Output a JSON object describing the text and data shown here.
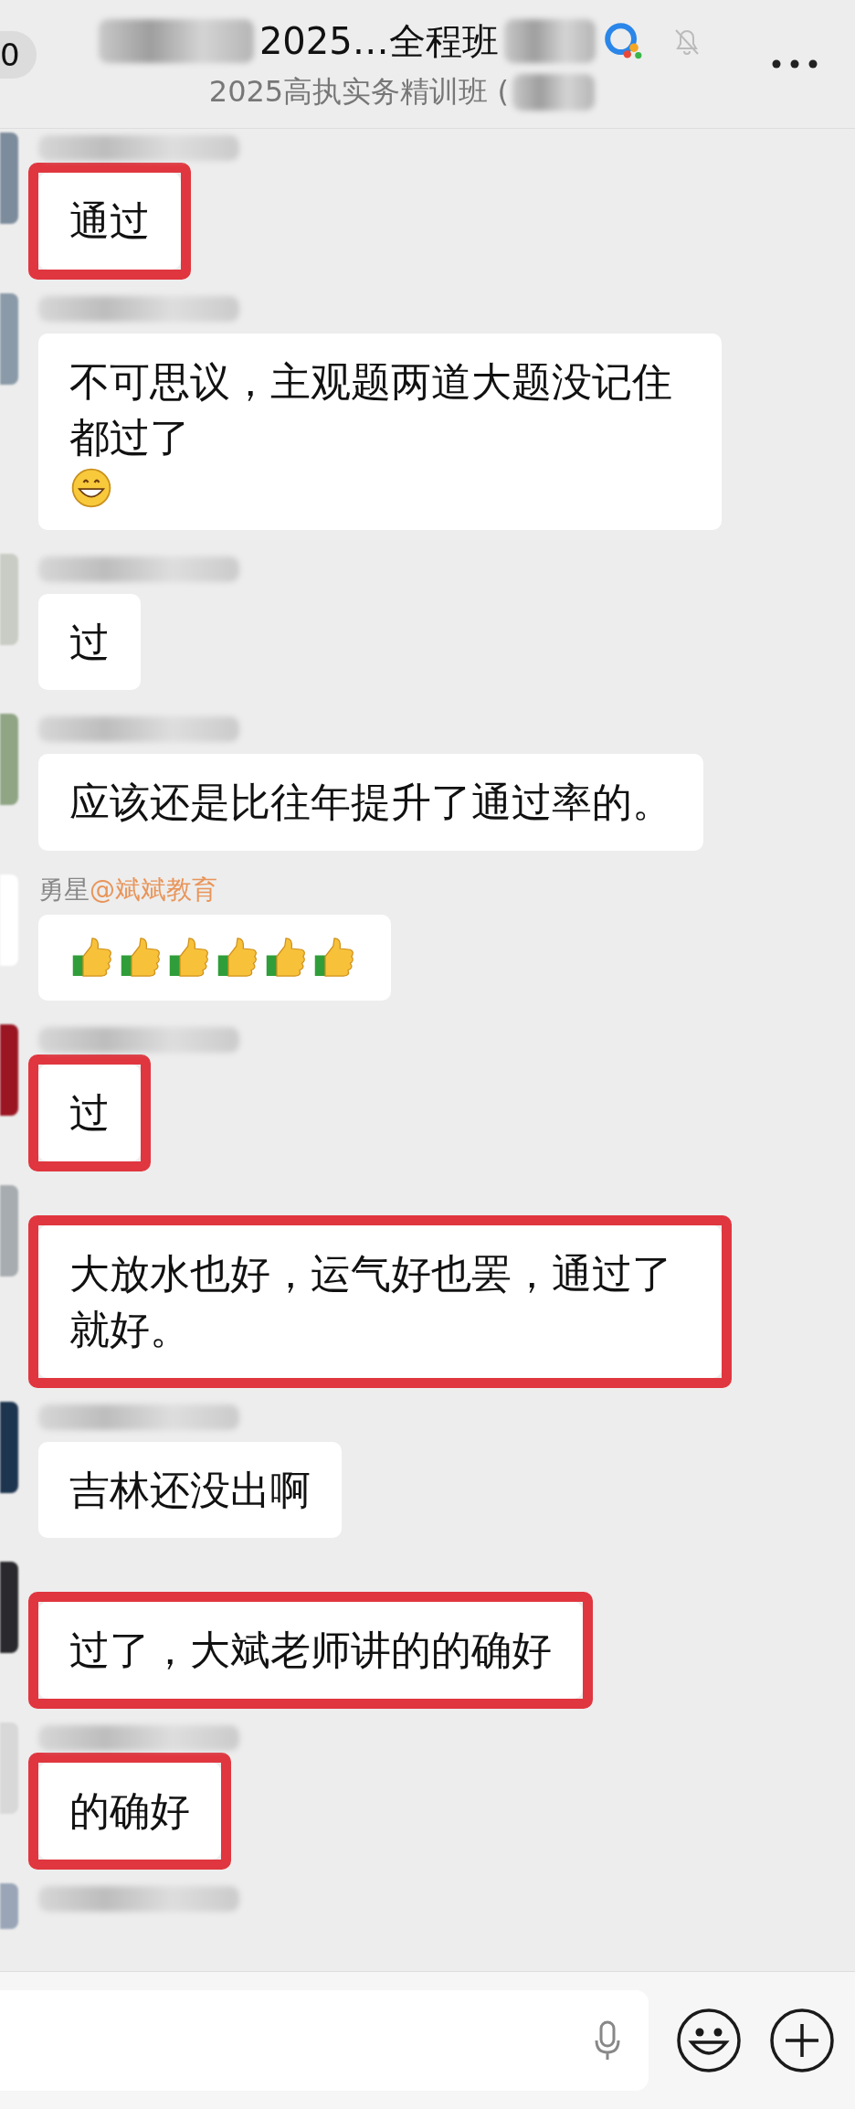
{
  "header": {
    "back_count": "0",
    "title": "2025…全程班",
    "title_blurred": true,
    "muted": true,
    "subtitle": "2025高执实务精训班 ("
  },
  "messages": [
    {
      "color": "#7d8c9c",
      "name_blurred": true,
      "text": "通过",
      "highlighted": true
    },
    {
      "color": "#8a9aa8",
      "name_blurred": true,
      "text": "不可思议，主观题两道大题没记住都过了",
      "emoji": [
        {
          "kind": "grin"
        }
      ],
      "highlighted": false
    },
    {
      "color": "#c9ccc4",
      "name_blurred": true,
      "text": "过",
      "highlighted": false
    },
    {
      "color": "#8fa584",
      "name_blurred": true,
      "text": "应该还是比往年提升了通过率的。",
      "highlighted": false
    },
    {
      "color": "#ffffff",
      "sender": "勇星",
      "mention": "@斌斌教育",
      "emoji": [
        {
          "kind": "thumbs"
        },
        {
          "kind": "thumbs"
        },
        {
          "kind": "thumbs"
        },
        {
          "kind": "thumbs"
        },
        {
          "kind": "thumbs"
        },
        {
          "kind": "thumbs"
        }
      ],
      "highlighted": false
    },
    {
      "color": "#9a1622",
      "name_blurred": true,
      "text": "过",
      "highlighted": true
    },
    {
      "color": "#a7acb0",
      "name_blurred": false,
      "text": "大放水也好，运气好也罢，通过了就好。",
      "highlighted": true
    },
    {
      "color": "#1e3550",
      "name_blurred": true,
      "text": "吉林还没出啊",
      "highlighted": false
    },
    {
      "color": "#2a2a2e",
      "name_blurred": false,
      "text": "过了，大斌老师讲的的确好",
      "highlighted": true
    },
    {
      "color": "#d8d8d8",
      "name_blurred": true,
      "text": "的确好",
      "highlighted": true
    },
    {
      "color": "#9aa6b8",
      "name_blurred": true
    }
  ]
}
